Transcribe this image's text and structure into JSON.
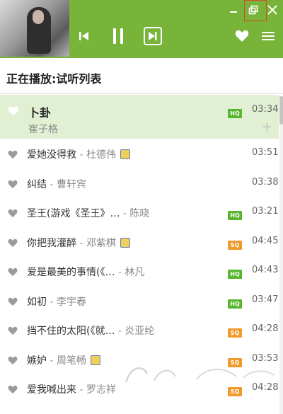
{
  "header": {
    "accent": "#78b33a",
    "controls": [
      "prev-icon",
      "pause-icon",
      "next-icon"
    ],
    "window_buttons": [
      "minimize-icon",
      "restore-icon",
      "close-icon"
    ]
  },
  "now_playing_label": "正在播放:试听列表",
  "current_track": {
    "title": "卜卦",
    "artist": "崔子格",
    "quality": "HQ",
    "duration": "03:34",
    "add": "+"
  },
  "tracks": [
    {
      "title": "爱她没得救",
      "artist": "杜德伟",
      "quality": "",
      "duration": "03:51",
      "mv": true
    },
    {
      "title": "纠结",
      "artist": "曹轩宾",
      "quality": "",
      "duration": "03:38",
      "mv": false
    },
    {
      "title": "圣王(游戏《圣王》…",
      "artist": "陈晓",
      "quality": "HQ",
      "duration": "03:21",
      "mv": false
    },
    {
      "title": "你把我灌醉",
      "artist": "邓紫棋",
      "quality": "SQ",
      "duration": "04:45",
      "mv": true
    },
    {
      "title": "爱是最美的事情(《…",
      "artist": "林凡",
      "quality": "HQ",
      "duration": "04:43",
      "mv": false
    },
    {
      "title": "如初",
      "artist": "李宇春",
      "quality": "HQ",
      "duration": "03:47",
      "mv": false
    },
    {
      "title": "挡不住的太阳(《就…",
      "artist": "炎亚纶",
      "quality": "SQ",
      "duration": "04:28",
      "mv": false
    },
    {
      "title": "嫉妒",
      "artist": "周笔畅",
      "quality": "SQ",
      "duration": "03:53",
      "mv": true
    },
    {
      "title": "爱我喊出来",
      "artist": "罗志祥",
      "quality": "SQ",
      "duration": "04:28",
      "mv": false
    }
  ]
}
